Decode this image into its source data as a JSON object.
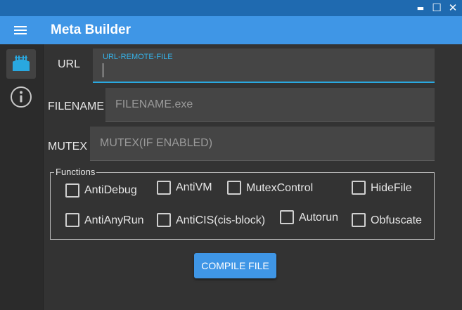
{
  "window": {
    "minimize_glyph": "▬",
    "maximize_glyph": "☐",
    "close_glyph": "✕"
  },
  "appbar": {
    "title": "Meta Builder",
    "menu_icon": "hamburger-icon"
  },
  "sidebar": {
    "items": [
      {
        "icon": "builder-icon",
        "active": true
      },
      {
        "icon": "info-icon",
        "active": false
      }
    ]
  },
  "form": {
    "url": {
      "label": "URL",
      "float_label": "URL-REMOTE-FILE",
      "value": "",
      "placeholder": ""
    },
    "filename": {
      "label": "FILENAME",
      "value": "",
      "placeholder": "FILENAME.exe"
    },
    "mutex": {
      "label": "MUTEX",
      "value": "",
      "placeholder": "MUTEX(IF ENABLED)"
    }
  },
  "functions": {
    "legend": "Functions",
    "options": [
      {
        "label": "AntiDebug",
        "checked": false
      },
      {
        "label": "AntiVM",
        "checked": false
      },
      {
        "label": "MutexControl",
        "checked": false
      },
      {
        "label": "HideFile",
        "checked": false
      },
      {
        "label": "AntiAnyRun",
        "checked": false
      },
      {
        "label": "AntiCIS(cis-block)",
        "checked": false
      },
      {
        "label": "Autorun",
        "checked": false
      },
      {
        "label": "Obfuscate",
        "checked": false
      }
    ]
  },
  "actions": {
    "compile_label": "COMPILE FILE"
  },
  "colors": {
    "titlebar": "#1f6ab0",
    "appbar": "#3f96e6",
    "accent": "#29a8e0",
    "background": "#333333",
    "sidebar": "#2b2b2b"
  }
}
